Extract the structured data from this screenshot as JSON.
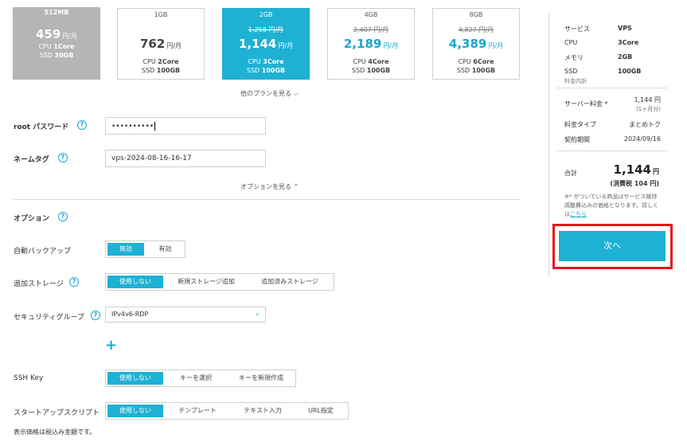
{
  "plans": [
    {
      "title": "512MB",
      "orig_price": "",
      "price": "459",
      "unit": "円/月",
      "cpu_label": "CPU",
      "cpu": "1Core",
      "ssd_label": "SSD",
      "ssd": "30GB",
      "state": "disabled"
    },
    {
      "title": "1GB",
      "orig_price": "",
      "price": "762",
      "unit": "円/月",
      "cpu_label": "CPU",
      "cpu": "2Core",
      "ssd_label": "SSD",
      "ssd": "100GB",
      "state": "normal"
    },
    {
      "title": "2GB",
      "orig_price": "1,258 円/月",
      "price": "1,144",
      "unit": "円/月",
      "cpu_label": "CPU",
      "cpu": "3Core",
      "ssd_label": "SSD",
      "ssd": "100GB",
      "state": "selected"
    },
    {
      "title": "4GB",
      "orig_price": "2,407 円/月",
      "price": "2,189",
      "unit": "円/月",
      "cpu_label": "CPU",
      "cpu": "4Core",
      "ssd_label": "SSD",
      "ssd": "100GB",
      "state": "normal"
    },
    {
      "title": "8GB",
      "orig_price": "4,827 円/月",
      "price": "4,389",
      "unit": "円/月",
      "cpu_label": "CPU",
      "cpu": "6Core",
      "ssd_label": "SSD",
      "ssd": "100GB",
      "state": "normal"
    }
  ],
  "links": {
    "other_plans": "他のプランを見る ⌵",
    "options_toggle": "オプションを見る ⌃"
  },
  "form": {
    "root_password": {
      "label": "root パスワード",
      "value": "••••••••••"
    },
    "name_tag": {
      "label": "ネームタグ",
      "value": "vps-2024-08-16-16-17"
    },
    "options_heading": "オプション",
    "auto_backup": {
      "label": "自動バックアップ",
      "options": [
        "無効",
        "有効"
      ],
      "selected": 0
    },
    "storage": {
      "label": "追加ストレージ",
      "options": [
        "使用しない",
        "新規ストレージ追加",
        "追加済みストレージ"
      ],
      "selected": 0
    },
    "security_group": {
      "label": "セキュリティグループ",
      "value": "IPv4v6-RDP"
    },
    "add_symbol": "+",
    "ssh_key": {
      "label": "SSH Key",
      "options": [
        "使用しない",
        "キーを選択",
        "キーを新規作成"
      ],
      "selected": 0
    },
    "startup_script": {
      "label": "スタートアップスクリプト",
      "options": [
        "使用しない",
        "テンプレート",
        "テキスト入力",
        "URL指定"
      ],
      "selected": 0
    },
    "help_symbol": "?"
  },
  "footnote": "表示価格は税込み金額です。",
  "summary": {
    "service_label": "サービス",
    "service": "VPS",
    "cpu_label": "CPU",
    "cpu": "3Core",
    "memory_label": "メモリ",
    "memory": "2GB",
    "ssd_label": "SSD",
    "ssd": "100GB",
    "breakdown_label": "料金内訳",
    "server_fee_label": "サーバー料金 *",
    "server_fee": "1,144 円",
    "server_fee_period": "(1ヶ月分)",
    "fee_type_label": "料金タイプ",
    "fee_type": "まとめトク",
    "contract_label": "契約期間",
    "contract": "2024/09/16",
    "total_label": "合計",
    "total_price": "1,144",
    "total_unit": "円",
    "tax": "(消費税 104 円)",
    "note": "※* がついている商品はサービス維持調整費込みの価格となります。詳しくは",
    "note_link": "こちら",
    "next_button": "次へ"
  },
  "colors": {
    "accent": "#1fb1d3",
    "highlight": "#e8161b",
    "disabled": "#b5b5b5"
  }
}
